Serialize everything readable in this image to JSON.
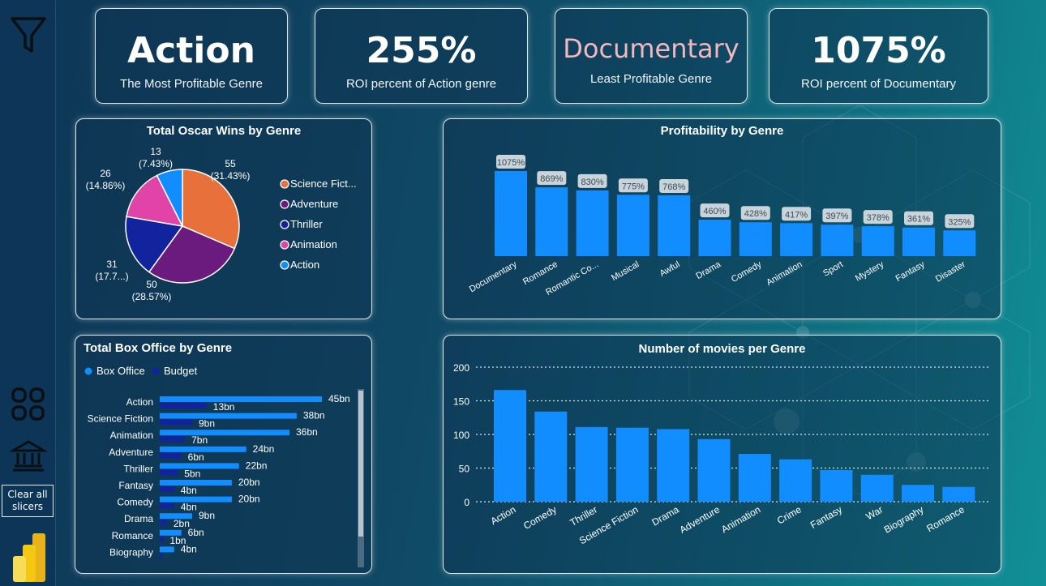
{
  "sidebar": {
    "clear_label_line1": "Clear all",
    "clear_label_line2": "slicers"
  },
  "kpis": [
    {
      "value": "Action",
      "label": "The Most Profitable Genre",
      "color": "#ffffff"
    },
    {
      "value": "255%",
      "label": "ROI percent of Action  genre",
      "color": "#ffffff"
    },
    {
      "value": "Documentary",
      "label": "Least Profitable Genre",
      "color": "#f2b7bf"
    },
    {
      "value": "1075%",
      "label": "ROI percent of Documentary",
      "color": "#ffffff"
    }
  ],
  "oscar": {
    "title": "Total Oscar Wins by Genre",
    "legend": [
      "Science Fict...",
      "Adventure",
      "Thriller",
      "Animation",
      "Action"
    ],
    "colors": [
      "#e8703a",
      "#6b1a7e",
      "#12239e",
      "#e044a7",
      "#118dff"
    ],
    "slice_labels": [
      [
        "55",
        "(31.43%)"
      ],
      [
        "50",
        "(28.57%)"
      ],
      [
        "31",
        "(17.7...)"
      ],
      [
        "26",
        "(14.86%)"
      ],
      [
        "13",
        "(7.43%)"
      ]
    ]
  },
  "profit": {
    "title": "Profitability by Genre"
  },
  "boxoffice": {
    "title": "Total Box Office by Genre",
    "legend_box": "Box Office",
    "legend_budget": "Budget",
    "colors": {
      "box": "#118dff",
      "budget": "#12239e"
    }
  },
  "movies": {
    "title": "Number of movies per Genre"
  },
  "chart_data": [
    {
      "type": "pie",
      "title": "Total Oscar Wins by Genre",
      "categories": [
        "Science Fiction",
        "Adventure",
        "Thriller",
        "Animation",
        "Action"
      ],
      "values": [
        55,
        50,
        31,
        26,
        13
      ],
      "legend": "right"
    },
    {
      "type": "bar",
      "title": "Profitability by Genre",
      "categories": [
        "Documentary",
        "Romance",
        "Romantic Co...",
        "Musical",
        "Awful",
        "Drama",
        "Comedy",
        "Animation",
        "Sport",
        "Mystery",
        "Fantasy",
        "Disaster"
      ],
      "values": [
        1075,
        869,
        830,
        775,
        768,
        460,
        428,
        417,
        397,
        378,
        361,
        325
      ],
      "data_labels": [
        "1075%",
        "869%",
        "830%",
        "775%",
        "768%",
        "460%",
        "428%",
        "417%",
        "397%",
        "378%",
        "361%",
        "325%"
      ],
      "ylim": [
        0,
        1075
      ]
    },
    {
      "type": "bar",
      "title": "Total Box Office by Genre",
      "orientation": "horizontal",
      "categories": [
        "Action",
        "Science Fiction",
        "Animation",
        "Adventure",
        "Thriller",
        "Fantasy",
        "Comedy",
        "Drama",
        "Romance",
        "Biography"
      ],
      "series": [
        {
          "name": "Box Office",
          "values": [
            45,
            38,
            36,
            24,
            22,
            20,
            20,
            9,
            6,
            4
          ],
          "labels": [
            "45bn",
            "38bn",
            "36bn",
            "24bn",
            "22bn",
            "20bn",
            "20bn",
            "9bn",
            "6bn",
            "4bn"
          ]
        },
        {
          "name": "Budget",
          "values": [
            13,
            9,
            7,
            6,
            5,
            4,
            4,
            2,
            1,
            0.5
          ],
          "labels": [
            "13bn",
            "9bn",
            "7bn",
            "6bn",
            "5bn",
            "4bn",
            "4bn",
            "2bn",
            "1bn",
            ""
          ]
        }
      ],
      "legend": "top-left"
    },
    {
      "type": "bar",
      "title": "Number of movies per Genre",
      "categories": [
        "Action",
        "Comedy",
        "Thriller",
        "Science Fiction",
        "Drama",
        "Adventure",
        "Animation",
        "Crime",
        "Fantasy",
        "War",
        "Biography",
        "Romance"
      ],
      "values": [
        166,
        134,
        111,
        110,
        108,
        93,
        71,
        63,
        47,
        40,
        25,
        22
      ],
      "yticks": [
        "0",
        "50",
        "100",
        "150",
        "200"
      ],
      "ylim": [
        0,
        200
      ],
      "grid": true
    }
  ]
}
